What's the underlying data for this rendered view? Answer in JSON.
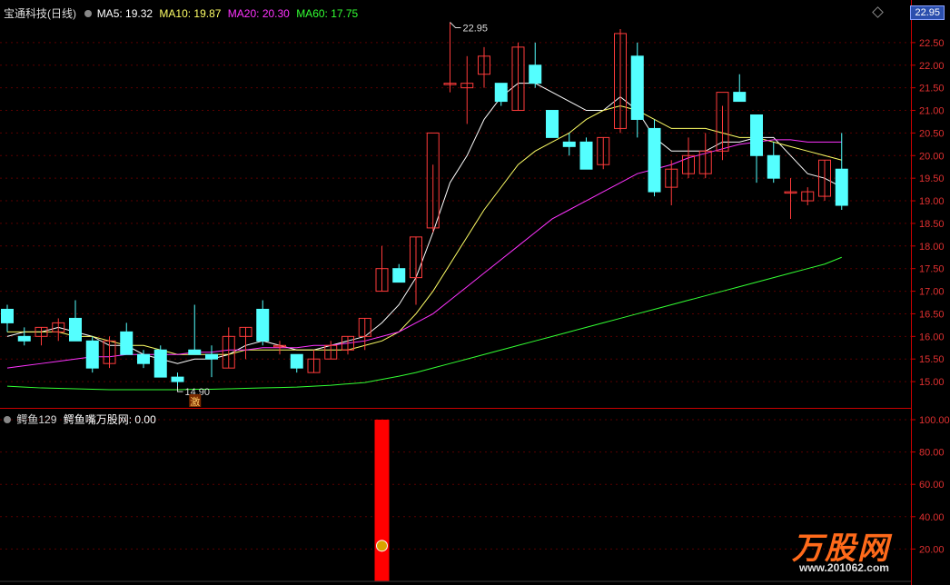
{
  "header": {
    "title": "宝通科技(日线)",
    "ma5": "MA5: 19.32",
    "ma10": "MA10: 19.87",
    "ma20": "MA20: 20.30",
    "ma60": "MA60: 17.75",
    "current_price": "22.95"
  },
  "indicator": {
    "name": "鳄鱼129",
    "label": "鳄鱼嘴万股网: 0.00"
  },
  "annotations": {
    "high_label": "22.95",
    "low_label": "14.90",
    "signal_char": "激"
  },
  "watermark": {
    "brand": "万股网",
    "url": "www.201062.com"
  },
  "colors": {
    "up": "#ff3b3b",
    "down": "#54ffff",
    "ma5": "#ffffff",
    "ma10": "#ffff66",
    "ma20": "#ff33ff",
    "ma60": "#33ff33",
    "axis": "#cc0000",
    "signal_bar": "#ff0000"
  },
  "chart_data": [
    {
      "type": "candlestick",
      "title": "宝通科技(日线)",
      "ylim": [
        14.6,
        23.0
      ],
      "yticks": [
        15.0,
        15.5,
        16.0,
        16.5,
        17.0,
        17.5,
        18.0,
        18.5,
        19.0,
        19.5,
        20.0,
        20.5,
        21.0,
        21.5,
        22.0,
        22.5
      ],
      "ohlc": [
        [
          16.6,
          16.7,
          16.1,
          16.3
        ],
        [
          16.0,
          16.2,
          15.8,
          15.9
        ],
        [
          16.0,
          16.2,
          15.8,
          16.2
        ],
        [
          16.1,
          16.4,
          15.9,
          16.3
        ],
        [
          16.4,
          16.8,
          15.9,
          15.9
        ],
        [
          15.9,
          16.0,
          15.2,
          15.3
        ],
        [
          15.4,
          16.0,
          15.3,
          15.9
        ],
        [
          16.1,
          16.3,
          15.6,
          15.6
        ],
        [
          15.6,
          15.7,
          15.3,
          15.4
        ],
        [
          15.7,
          15.8,
          15.1,
          15.1
        ],
        [
          15.1,
          15.2,
          14.9,
          15.0
        ],
        [
          15.7,
          16.7,
          15.6,
          15.6
        ],
        [
          15.6,
          15.8,
          15.1,
          15.5
        ],
        [
          15.3,
          16.2,
          15.3,
          16.0
        ],
        [
          16.0,
          16.2,
          15.5,
          16.2
        ],
        [
          16.6,
          16.8,
          15.8,
          15.9
        ],
        [
          15.8,
          15.9,
          15.6,
          15.8
        ],
        [
          15.6,
          15.6,
          15.2,
          15.3
        ],
        [
          15.2,
          15.7,
          15.2,
          15.5
        ],
        [
          15.5,
          15.9,
          15.5,
          15.8
        ],
        [
          15.7,
          16.0,
          15.6,
          16.0
        ],
        [
          16.0,
          16.4,
          15.7,
          16.4
        ],
        [
          17.0,
          18.0,
          17.0,
          17.5
        ],
        [
          17.5,
          17.6,
          17.2,
          17.2
        ],
        [
          17.3,
          18.2,
          16.7,
          18.2
        ],
        [
          18.4,
          19.8,
          18.3,
          20.5
        ],
        [
          21.6,
          22.95,
          21.4,
          21.6
        ],
        [
          21.5,
          22.2,
          20.7,
          21.6
        ],
        [
          21.8,
          22.4,
          21.5,
          22.2
        ],
        [
          21.6,
          21.5,
          21.1,
          21.2
        ],
        [
          21.0,
          22.5,
          21.0,
          22.4
        ],
        [
          22.0,
          22.5,
          21.5,
          21.6
        ],
        [
          21.0,
          20.4,
          20.4,
          20.4
        ],
        [
          20.3,
          20.5,
          20.0,
          20.2
        ],
        [
          20.3,
          20.4,
          19.7,
          19.7
        ],
        [
          19.8,
          20.4,
          19.7,
          20.4
        ],
        [
          20.6,
          22.8,
          20.5,
          22.7
        ],
        [
          22.2,
          22.5,
          20.4,
          20.8
        ],
        [
          20.6,
          20.8,
          19.1,
          19.2
        ],
        [
          19.3,
          19.9,
          18.9,
          19.7
        ],
        [
          19.6,
          20.4,
          19.5,
          20.0
        ],
        [
          19.6,
          20.5,
          19.5,
          20.1
        ],
        [
          20.1,
          21.1,
          19.9,
          21.4
        ],
        [
          21.4,
          21.8,
          21.2,
          21.2
        ],
        [
          20.9,
          20.9,
          19.4,
          20.0
        ],
        [
          20.0,
          20.3,
          19.4,
          19.5
        ],
        [
          19.2,
          19.5,
          18.6,
          19.2
        ],
        [
          19.0,
          19.3,
          18.9,
          19.2
        ],
        [
          19.1,
          19.9,
          19.0,
          19.9
        ],
        [
          19.7,
          20.5,
          18.8,
          18.9
        ]
      ],
      "series": [
        {
          "name": "MA5",
          "values": [
            16.0,
            16.1,
            16.1,
            16.2,
            16.1,
            16.0,
            15.8,
            15.8,
            15.6,
            15.5,
            15.4,
            15.5,
            15.5,
            15.6,
            15.8,
            15.9,
            15.8,
            15.7,
            15.7,
            15.8,
            15.9,
            16.0,
            16.3,
            16.7,
            17.3,
            18.3,
            19.4,
            20.0,
            20.8,
            21.3,
            21.6,
            21.6,
            21.4,
            21.2,
            21.0,
            21.0,
            21.3,
            21.0,
            20.4,
            20.1,
            20.1,
            20.1,
            20.3,
            20.3,
            20.4,
            20.4,
            20.0,
            19.6,
            19.5,
            19.3
          ]
        },
        {
          "name": "MA10",
          "values": [
            16.1,
            16.1,
            16.1,
            16.1,
            16.0,
            16.0,
            15.9,
            15.8,
            15.8,
            15.7,
            15.6,
            15.6,
            15.6,
            15.6,
            15.7,
            15.7,
            15.7,
            15.7,
            15.7,
            15.7,
            15.7,
            15.8,
            15.9,
            16.1,
            16.5,
            17.0,
            17.6,
            18.2,
            18.8,
            19.3,
            19.8,
            20.1,
            20.3,
            20.5,
            20.8,
            21.0,
            21.1,
            21.0,
            20.8,
            20.6,
            20.6,
            20.6,
            20.5,
            20.4,
            20.4,
            20.3,
            20.2,
            20.1,
            20.0,
            19.9
          ]
        },
        {
          "name": "MA20",
          "values": [
            15.3,
            15.35,
            15.4,
            15.45,
            15.5,
            15.55,
            15.55,
            15.6,
            15.6,
            15.6,
            15.6,
            15.65,
            15.65,
            15.7,
            15.7,
            15.75,
            15.75,
            15.75,
            15.8,
            15.8,
            15.85,
            15.9,
            16.0,
            16.1,
            16.3,
            16.5,
            16.8,
            17.1,
            17.4,
            17.7,
            18.0,
            18.3,
            18.6,
            18.8,
            19.0,
            19.2,
            19.4,
            19.6,
            19.7,
            19.8,
            19.95,
            20.05,
            20.15,
            20.25,
            20.3,
            20.35,
            20.35,
            20.3,
            20.3,
            20.3
          ]
        },
        {
          "name": "MA60",
          "values": [
            14.9,
            14.88,
            14.86,
            14.85,
            14.84,
            14.83,
            14.82,
            14.82,
            14.82,
            14.82,
            14.82,
            14.83,
            14.83,
            14.84,
            14.85,
            14.86,
            14.87,
            14.88,
            14.9,
            14.92,
            14.95,
            14.98,
            15.05,
            15.12,
            15.2,
            15.3,
            15.4,
            15.5,
            15.6,
            15.7,
            15.8,
            15.9,
            16.0,
            16.1,
            16.2,
            16.3,
            16.4,
            16.5,
            16.6,
            16.7,
            16.8,
            16.9,
            17.0,
            17.1,
            17.2,
            17.3,
            17.4,
            17.5,
            17.6,
            17.75
          ]
        }
      ]
    },
    {
      "type": "bar",
      "title": "鳄鱼129",
      "ylim": [
        0,
        100
      ],
      "yticks": [
        20.0,
        40.0,
        60.0,
        80.0,
        100.0
      ],
      "values": [
        0,
        0,
        0,
        0,
        0,
        0,
        0,
        0,
        0,
        0,
        0,
        0,
        0,
        0,
        0,
        0,
        0,
        0,
        0,
        0,
        0,
        0,
        100,
        0,
        0,
        0,
        0,
        0,
        0,
        0,
        0,
        0,
        0,
        0,
        0,
        0,
        0,
        0,
        0,
        0,
        0,
        0,
        0,
        0,
        0,
        0,
        0,
        0,
        0,
        0
      ]
    }
  ]
}
